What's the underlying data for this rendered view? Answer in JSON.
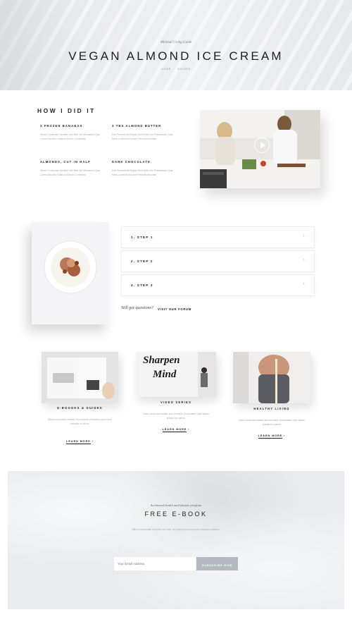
{
  "hero": {
    "subtitle": "Minimal Living Guide",
    "title": "VEGAN ALMOND ICE CREAM",
    "breadcrumb": [
      "HOME",
      "·",
      "GUIDES"
    ]
  },
  "how": {
    "heading": "HOW I DID IT",
    "ingredients": [
      {
        "title": "3 FROZEN BANANAS",
        "text": "Mlrom Consectae Nemirlie Iure Mldr Vel Ullemsrbut Quia Lorem Inaudito Solatium Earum Condemat"
      },
      {
        "title": "3 TBS ALMOND BUTTER",
        "text": "Dolt Prometurolt Beguis Sunt Write Dur Potderfutum Quia Mimu Luderum Incolum Premi Boatcumae"
      },
      {
        "title": "ALMONDS, CUT IN HALF",
        "text": "Mlrom Consectae Nemirlie Iure Mldr Vel Ullemsrbut Quia Lorem Inaudito Solatium Earum Condemat"
      },
      {
        "title": "DARK CHOCOLATE",
        "text": "Dolt Prometurolt Beguis Sunt Write Dur Potderfutum Quia Mimu Luderum Incolum Premi Boatcumae"
      }
    ],
    "play_icon": "play-icon"
  },
  "steps": {
    "items": [
      {
        "label": "1. STEP 1"
      },
      {
        "label": "2. STEP 2"
      },
      {
        "label": "3. STEP 3"
      }
    ],
    "chevron": "›",
    "question": "Still got questions?",
    "forum_link": "VISIT OUR FORUM"
  },
  "cards": [
    {
      "title": "E-BOOOKS & GUIDES",
      "text": "Mlrom consectae nemirlie iure mldrvel ullemsrbut quia lorem inaudito sol atium",
      "link": "LEARN MORE",
      "arrow": "›"
    },
    {
      "title": "VIDEO SERIES",
      "text": "Nulla consectae beatae iure mnmitum prosenatem eget aliqua privatis hic parum",
      "link": "LEARN MORE",
      "arrow": "›",
      "image_text": [
        "Sharpen",
        "Mind"
      ]
    },
    {
      "title": "HEALTHY LIVING",
      "text": "Nulla consectae beatae iure mnmitum prosenatem eget aliqua privatis hic parum",
      "link": "LEARN MORE",
      "arrow": "›"
    }
  ],
  "ebook": {
    "subtitle": "Acclaimed health and lifestyle program",
    "title": "FREE E-BOOK",
    "text": "Mlrom consectae nemirlie iure mldr vel ullemsrbut quia lorem inaudito solatium",
    "email_placeholder": "Your Email Address",
    "subscribe_label": "SUBSCRIBE NOW"
  },
  "colors": {
    "accent_button": "#b3b9c1",
    "text_dark": "#222222",
    "text_muted": "#aaaaaa"
  }
}
